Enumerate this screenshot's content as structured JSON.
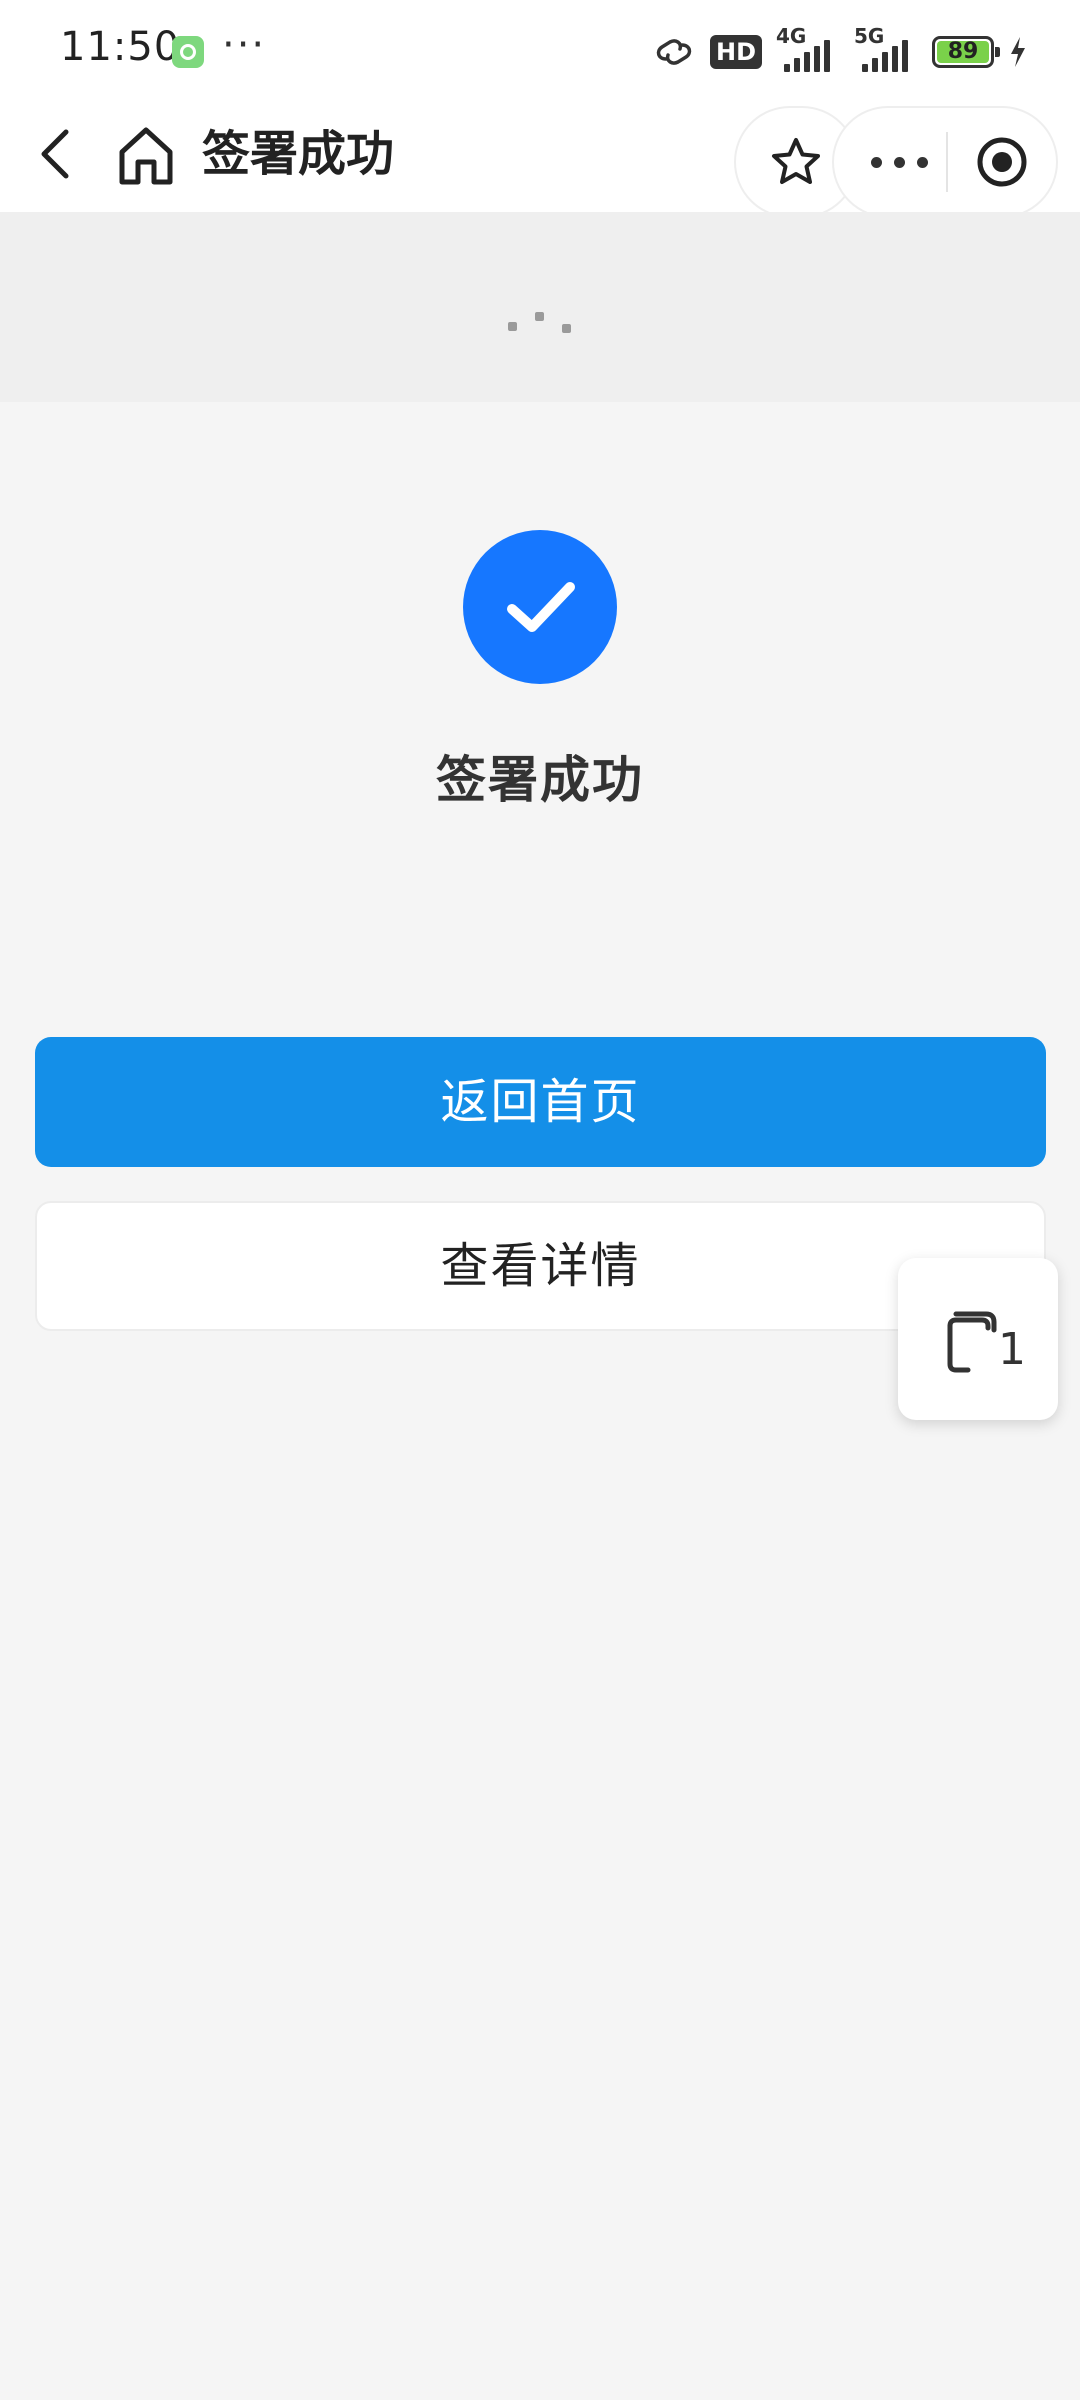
{
  "status_bar": {
    "time": "11:50",
    "dots": "···",
    "hd_badge": "HD",
    "net_4g": "4G",
    "net_5g": "5G",
    "battery": "89",
    "battery_color": "#7ad14a"
  },
  "nav": {
    "title": "签署成功",
    "icons": [
      "back-arrow-icon",
      "home-icon",
      "star-icon",
      "more-dots-icon",
      "close-target-icon"
    ]
  },
  "success": {
    "title": "签署成功",
    "icon": "checkmark-icon",
    "color": "#1677ff"
  },
  "buttons": {
    "primary_label": "返回首页",
    "primary_color": "#148fe8",
    "secondary_label": "查看详情"
  },
  "floating": {
    "count": "1",
    "icon": "copy-stack-icon"
  }
}
